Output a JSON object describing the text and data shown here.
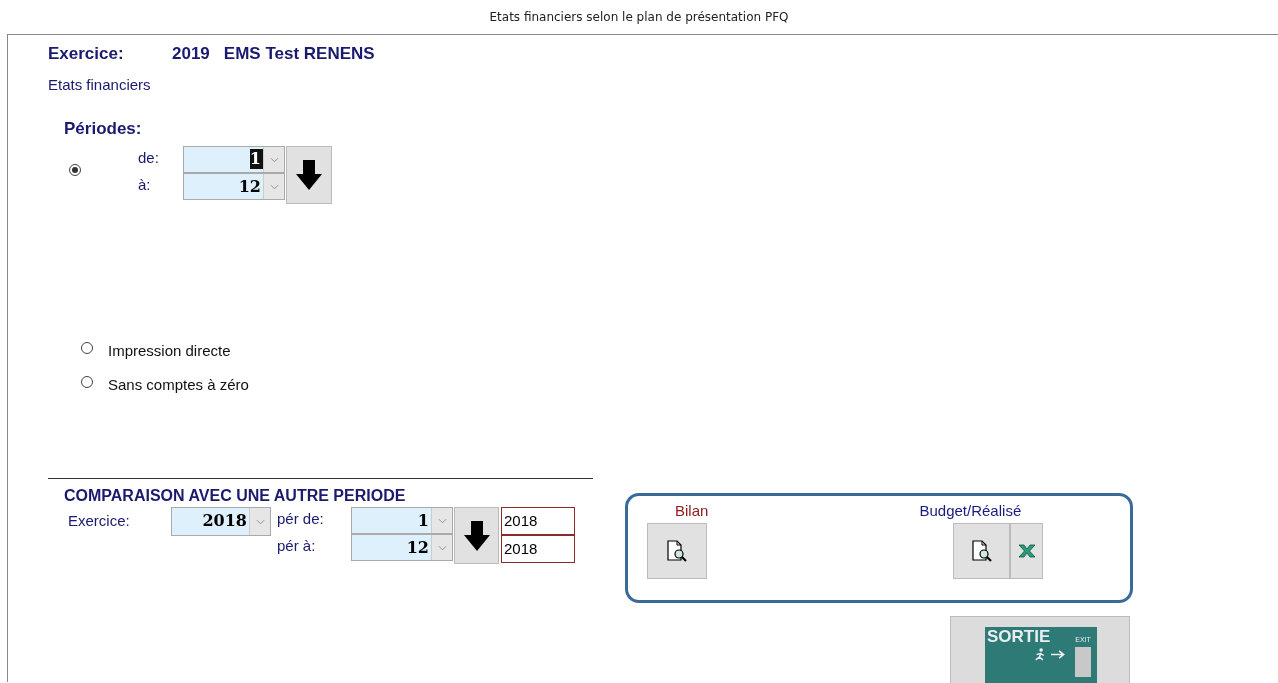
{
  "window": {
    "title": "Etats financiers selon le plan de présentation PFQ"
  },
  "header": {
    "label": "Exercice:",
    "year": "2019",
    "company": "EMS Test RENENS"
  },
  "subtitle": "Etats financiers",
  "periods": {
    "label": "Périodes:",
    "selected": true,
    "from_label": "de:",
    "from": "1",
    "from_highlighted": true,
    "to_label": "à:",
    "to": "12"
  },
  "options": [
    {
      "label": "Impression directe",
      "selected": false
    },
    {
      "label": "Sans comptes à zéro",
      "selected": false
    }
  ],
  "comparison": {
    "title": "COMPARAISON AVEC UNE AUTRE PERIODE",
    "year_label": "Exercice:",
    "year": "2018",
    "from_label": "pér de:",
    "from": "1",
    "to_label": "pér à:",
    "to": "12",
    "from_year": "2018",
    "to_year": "2018"
  },
  "reports": [
    {
      "label": "Bilan",
      "color": "#8b1a1a",
      "buttons": [
        {
          "kind": "preview"
        }
      ]
    },
    {
      "label": "Budget/Réalisé",
      "color": "#1a1a80",
      "buttons": [
        {
          "kind": "preview"
        },
        {
          "kind": "excel"
        }
      ]
    }
  ],
  "exit_button": {
    "label": "SORTIE",
    "tag": "EXIT"
  }
}
